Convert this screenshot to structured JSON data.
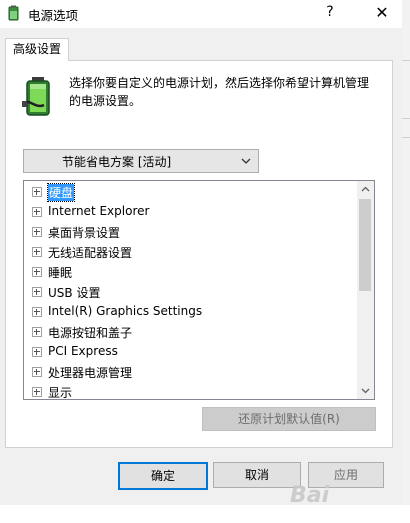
{
  "window": {
    "title": "电源选项",
    "help_glyph": "?",
    "close_glyph": "✕"
  },
  "tabs": [
    {
      "label": "高级设置"
    }
  ],
  "panel": {
    "description": "选择你要自定义的电源计划，然后选择你希望计算机管理的电源设置。",
    "plan_select": {
      "value": "节能省电方案 [活动]"
    }
  },
  "tree": {
    "items": [
      {
        "label": "硬盘",
        "selected": true
      },
      {
        "label": "Internet Explorer"
      },
      {
        "label": "桌面背景设置"
      },
      {
        "label": "无线适配器设置"
      },
      {
        "label": "睡眠"
      },
      {
        "label": "USB 设置"
      },
      {
        "label": "Intel(R) Graphics Settings"
      },
      {
        "label": "电源按钮和盖子"
      },
      {
        "label": "PCI Express"
      },
      {
        "label": "处理器电源管理"
      },
      {
        "label": "显示"
      }
    ]
  },
  "buttons": {
    "restore_defaults": "还原计划默认值(R)",
    "ok": "确定",
    "cancel": "取消",
    "apply": "应用"
  },
  "watermark": "Bai"
}
